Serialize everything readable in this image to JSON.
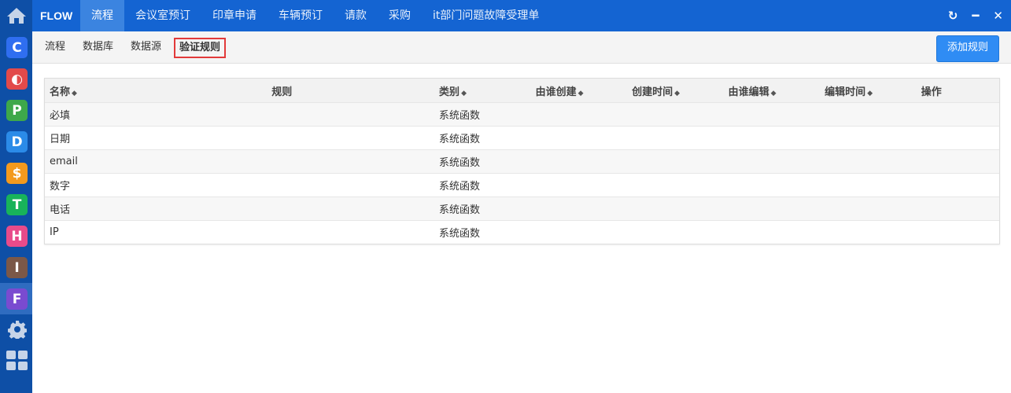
{
  "brand": "FLOW",
  "top_tabs": [
    "流程",
    "会议室预订",
    "印章申请",
    "车辆预订",
    "请款",
    "采购",
    "it部门问题故障受理单"
  ],
  "sub_tabs": [
    "流程",
    "数据库",
    "数据源",
    "验证规则"
  ],
  "add_button": "添加规则",
  "sidebar_apps": [
    {
      "letter": "C",
      "color": "#2f6ef0"
    },
    {
      "letter": "◐",
      "color": "#e24a4a"
    },
    {
      "letter": "P",
      "color": "#3ea84a"
    },
    {
      "letter": "D",
      "color": "#2b8be8"
    },
    {
      "letter": "$",
      "color": "#f39a1e"
    },
    {
      "letter": "T",
      "color": "#18b35a"
    },
    {
      "letter": "H",
      "color": "#e84b8a"
    },
    {
      "letter": "I",
      "color": "#7b5848"
    },
    {
      "letter": "F",
      "color": "#7a4bd0"
    }
  ],
  "table": {
    "headers": [
      "名称",
      "规则",
      "类别",
      "由谁创建",
      "创建时间",
      "由谁编辑",
      "编辑时间",
      "操作"
    ],
    "rows": [
      {
        "name": "必填",
        "category": "系统函数"
      },
      {
        "name": "日期",
        "category": "系统函数"
      },
      {
        "name": "email",
        "category": "系统函数"
      },
      {
        "name": "数字",
        "category": "系统函数"
      },
      {
        "name": "电话",
        "category": "系统函数"
      },
      {
        "name": "IP",
        "category": "系统函数"
      }
    ]
  }
}
